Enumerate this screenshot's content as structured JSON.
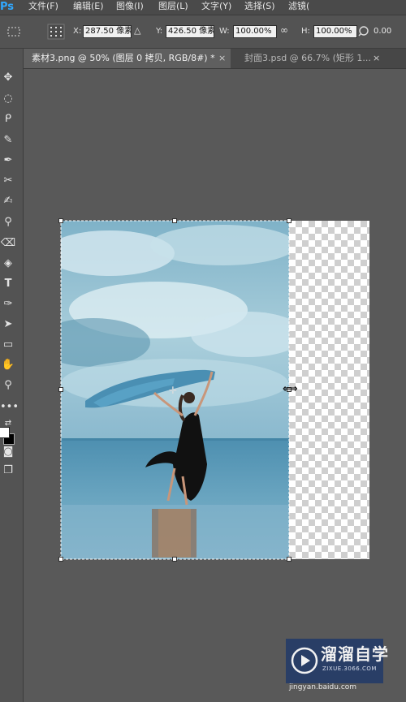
{
  "app": {
    "logo": "Ps"
  },
  "menu": {
    "items": [
      "文件(F)",
      "编辑(E)",
      "图像(I)",
      "图层(L)",
      "文字(Y)",
      "选择(S)",
      "滤镜("
    ]
  },
  "options": {
    "x_label": "X:",
    "x_value": "287.50 像素",
    "y_label": "Y:",
    "y_value": "426.50 像素",
    "w_label": "W:",
    "w_value": "100.00%",
    "h_label": "H:",
    "h_value": "100.00%",
    "angle_value": "0.00"
  },
  "tabs": [
    {
      "label": "素材3.png @ 50% (图层 0 拷贝, RGB/8#) *",
      "close": "×"
    },
    {
      "label": "封面3.psd @ 66.7% (矩形 1...",
      "close": "×"
    }
  ],
  "watermark": {
    "title": "溜溜自学",
    "subtitle": "ZIXUE.3066.COM",
    "site": "jingyan.baidu.com",
    "color": "#263c68"
  },
  "colors": {
    "workspace": "#595959",
    "panel": "#535353",
    "accent": "#31a8ff"
  }
}
